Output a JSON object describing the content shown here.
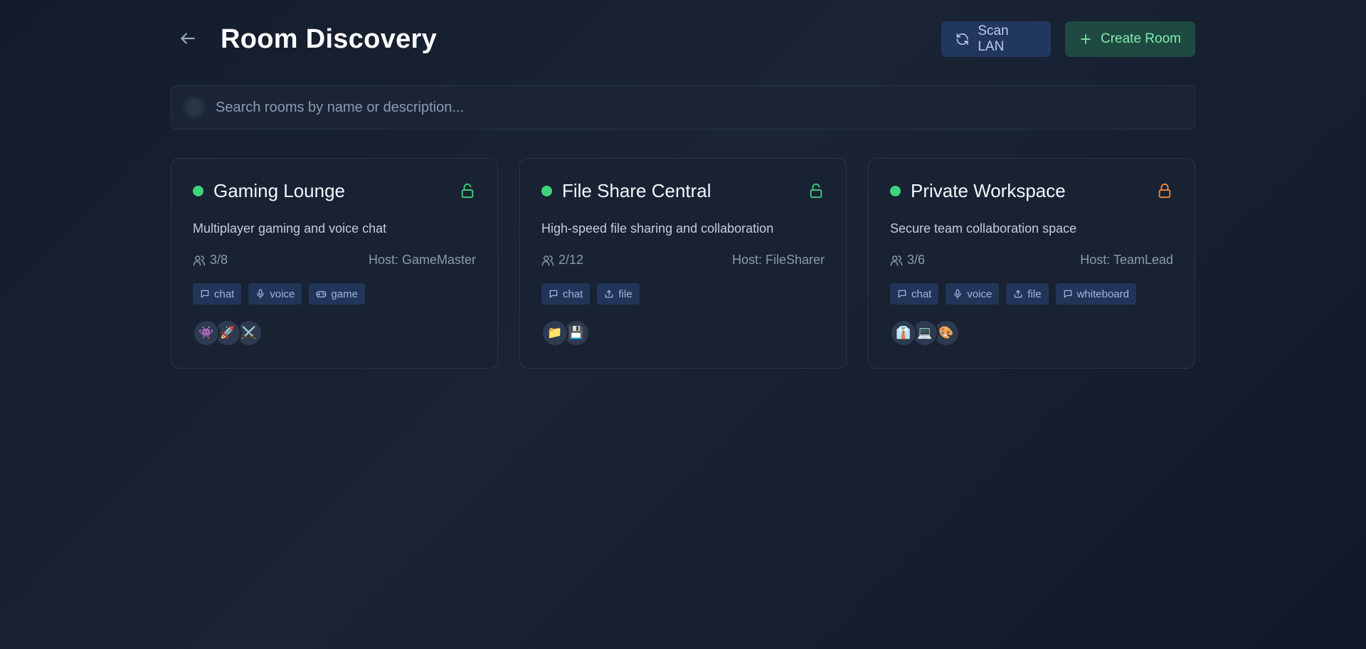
{
  "header": {
    "title": "Room Discovery",
    "scan_label": "Scan LAN",
    "create_label": "Create Room"
  },
  "search": {
    "placeholder": "Search rooms by name or description..."
  },
  "colors": {
    "online": "#3fd47b",
    "unlocked": "#3fd47b",
    "locked": "#f0883e"
  },
  "rooms": [
    {
      "name": "Gaming Lounge",
      "description": "Multiplayer gaming and voice chat",
      "occupancy": "3/8",
      "host": "Host: GameMaster",
      "lock": "unlocked",
      "tags": [
        {
          "label": "chat",
          "icon": "chat-icon"
        },
        {
          "label": "voice",
          "icon": "mic-icon"
        },
        {
          "label": "game",
          "icon": "gamepad-icon"
        }
      ],
      "avatars": [
        "👾",
        "🚀",
        "⚔️"
      ]
    },
    {
      "name": "File Share Central",
      "description": "High-speed file sharing and collaboration",
      "occupancy": "2/12",
      "host": "Host: FileSharer",
      "lock": "unlocked",
      "tags": [
        {
          "label": "chat",
          "icon": "chat-icon"
        },
        {
          "label": "file",
          "icon": "upload-icon"
        }
      ],
      "avatars": [
        "📁",
        "💾"
      ]
    },
    {
      "name": "Private Workspace",
      "description": "Secure team collaboration space",
      "occupancy": "3/6",
      "host": "Host: TeamLead",
      "lock": "locked",
      "tags": [
        {
          "label": "chat",
          "icon": "chat-icon"
        },
        {
          "label": "voice",
          "icon": "mic-icon"
        },
        {
          "label": "file",
          "icon": "upload-icon"
        },
        {
          "label": "whiteboard",
          "icon": "chat-icon"
        }
      ],
      "avatars": [
        "👔",
        "💻",
        "🎨"
      ]
    }
  ]
}
